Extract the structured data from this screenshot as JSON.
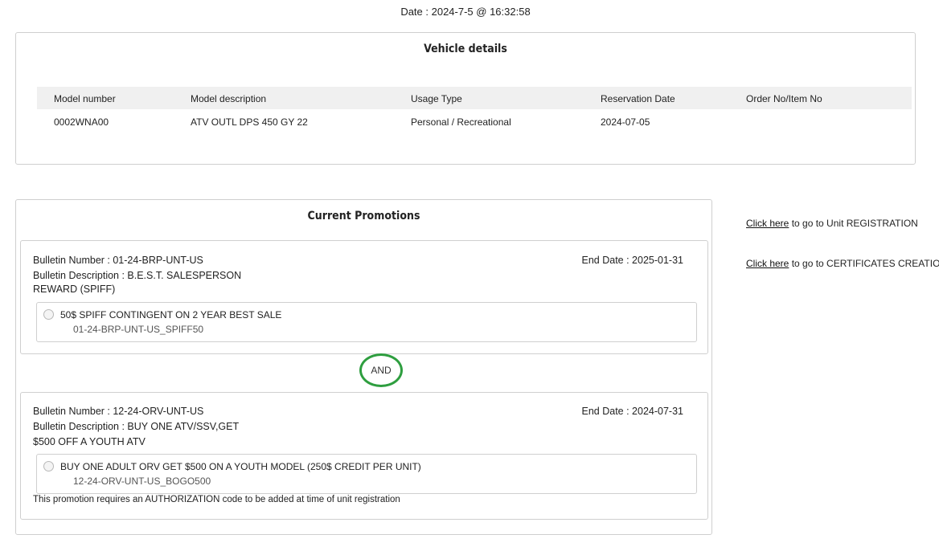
{
  "header": {
    "date_line": "Date : 2024-7-5 @ 16:32:58"
  },
  "vehicle": {
    "title": "Vehicle details",
    "columns": [
      "Model number",
      "Model description",
      "Usage Type",
      "Reservation Date",
      "Order No/Item No"
    ],
    "row": [
      "0002WNA00",
      "ATV OUTL DPS 450 GY 22",
      "Personal / Recreational",
      "2024-07-05",
      ""
    ]
  },
  "promotions": {
    "title": "Current Promotions",
    "and_label": "AND",
    "bulletins": [
      {
        "number": "Bulletin Number : 01-24-BRP-UNT-US",
        "description": "Bulletin Description : B.E.S.T. SALESPERSON",
        "description_cont": "REWARD (SPIFF)",
        "end_date": "End Date : 2025-01-31",
        "option_label": "50$ SPIFF CONTINGENT ON 2 YEAR BEST SALE",
        "option_code": "01-24-BRP-UNT-US_SPIFF50",
        "note": ""
      },
      {
        "number": "Bulletin Number : 12-24-ORV-UNT-US",
        "description": "Bulletin Description : BUY ONE ATV/SSV,GET",
        "description_cont": "$500 OFF A YOUTH ATV",
        "end_date": "End Date : 2024-07-31",
        "option_label": "BUY ONE ADULT ORV GET $500 ON A YOUTH MODEL (250$ CREDIT PER UNIT)",
        "option_code": "12-24-ORV-UNT-US_BOGO500",
        "note": "This promotion requires an AUTHORIZATION code to be added at time of unit registration"
      }
    ]
  },
  "side_links": [
    {
      "link_text": "Click here",
      "rest": " to go to Unit REGISTRATION"
    },
    {
      "link_text": "Click here",
      "rest": " to go to CERTIFICATES CREATION"
    }
  ],
  "colors": {
    "and_ring": "#2e9e3f",
    "table_header_bg": "#f0f0f0",
    "border": "#cfcfcf"
  }
}
